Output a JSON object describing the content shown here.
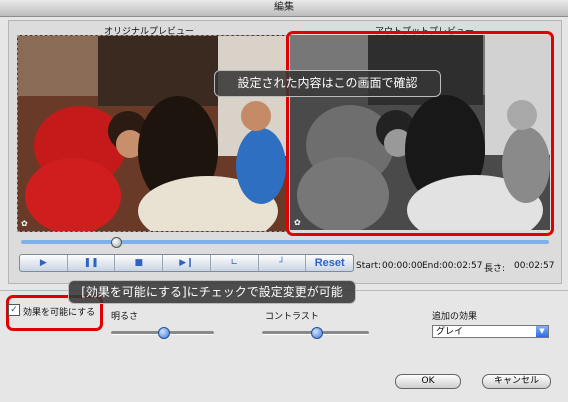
{
  "window": {
    "title": "編集"
  },
  "preview": {
    "original_label": "オリジナルプレビュー",
    "output_label": "アウトプットプレビュー",
    "callout_output": "設定された内容はこの画面で確認",
    "callout_enable": "[効果を可能にする]にチェックで設定変更が可能"
  },
  "controls": {
    "reset_label": "Reset",
    "start_label": "Start:",
    "start_value": "00:00:00",
    "end_label": "End:",
    "end_value": "00:02:57",
    "length_label": "長さ:",
    "length_value": "00:02:57",
    "timeline_position": 0.18
  },
  "icons": {
    "play": "play-icon",
    "pause": "pause-icon",
    "stop": "stop-icon",
    "next": "next-frame-icon",
    "mark_in": "mark-in-icon",
    "mark_out": "mark-out-icon"
  },
  "effects": {
    "enable_label": "効果を可能にする",
    "enable_checked": true,
    "brightness_label": "明るさ",
    "brightness_value": 0.5,
    "contrast_label": "コントラスト",
    "contrast_value": 0.5,
    "extra_label": "追加の効果",
    "extra_selected": "グレイ"
  },
  "buttons": {
    "ok": "OK",
    "cancel": "キャンセル"
  },
  "colors": {
    "highlight": "#e00000",
    "accent": "#2c63c8"
  }
}
